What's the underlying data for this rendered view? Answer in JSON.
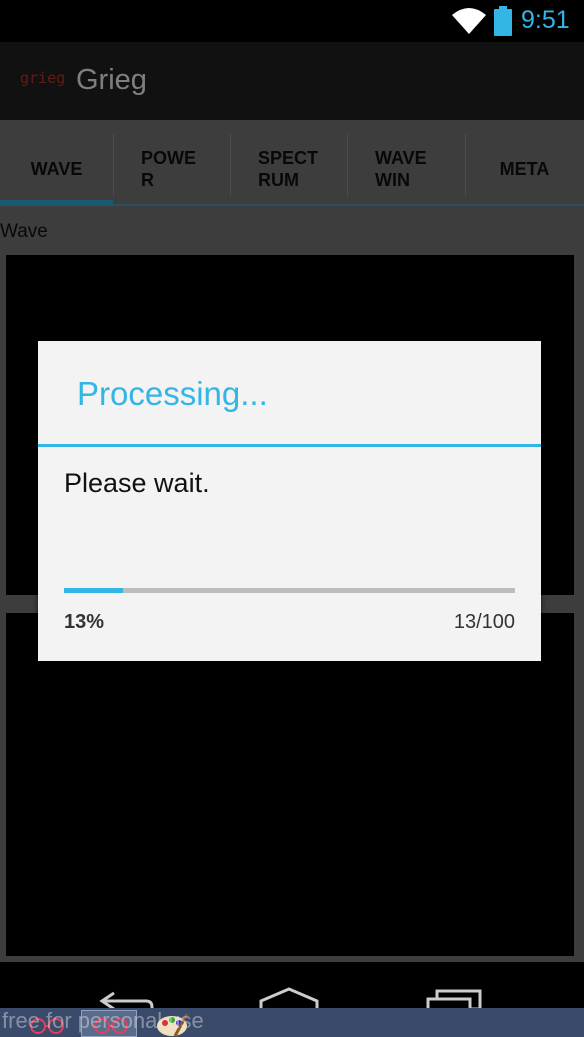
{
  "status_bar": {
    "time": "9:51",
    "wifi_icon": "wifi-icon",
    "battery_icon": "battery-icon"
  },
  "action_bar": {
    "logo_text": "grieg",
    "title": "Grieg"
  },
  "tabs": [
    {
      "label": "WAVE",
      "active": true
    },
    {
      "label": "POWER",
      "active": false
    },
    {
      "label": "SPECTRUM",
      "active": false
    },
    {
      "label": "WAVE WIN",
      "active": false
    },
    {
      "label": "META",
      "active": false
    }
  ],
  "content": {
    "section_label": "Wave"
  },
  "dialog": {
    "title": "Processing...",
    "message": "Please wait.",
    "progress": {
      "value": 13,
      "max": 100,
      "percent_text": "13%",
      "count_text": "13/100"
    }
  },
  "nav_bar": {
    "back_icon": "back-icon",
    "home_icon": "home-icon",
    "recents_icon": "recents-icon"
  },
  "taskbar": {
    "watermark_text": "free for personal use"
  },
  "colors": {
    "accent": "#33b5e5",
    "action_bar": "#222222",
    "content_bg": "#7b7b7b",
    "dialog_bg": "#f3f3f3",
    "logo": "#c0392b"
  }
}
